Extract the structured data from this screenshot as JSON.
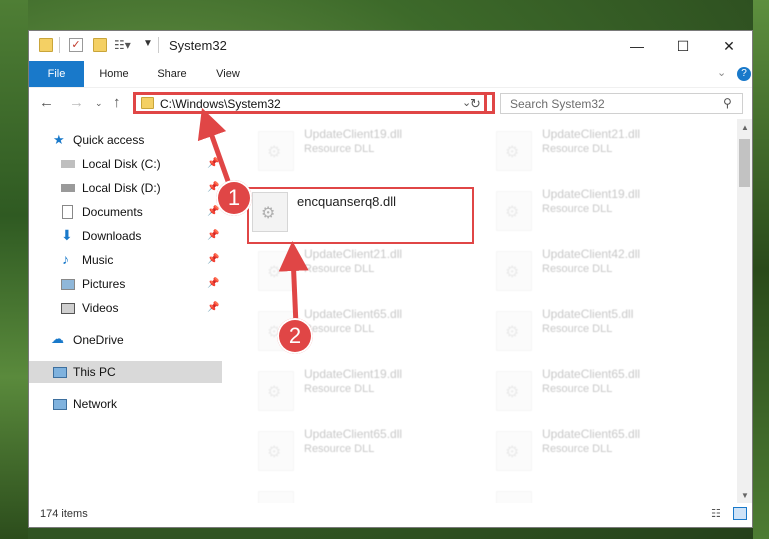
{
  "window": {
    "title": "System32"
  },
  "ribbon": {
    "tabs": [
      "File",
      "Home",
      "Share",
      "View"
    ]
  },
  "address": {
    "path": "C:\\Windows\\System32"
  },
  "search": {
    "placeholder": "Search System32"
  },
  "sidebar": {
    "items": [
      {
        "label": "Quick access"
      },
      {
        "label": "Local Disk (C:)"
      },
      {
        "label": "Local Disk (D:)"
      },
      {
        "label": "Documents"
      },
      {
        "label": "Downloads"
      },
      {
        "label": "Music"
      },
      {
        "label": "Pictures"
      },
      {
        "label": "Videos"
      },
      {
        "label": "OneDrive"
      },
      {
        "label": "This PC"
      },
      {
        "label": "Network"
      }
    ]
  },
  "files": [
    {
      "name": "UpdateClient19.dll",
      "type": "Resource DLL"
    },
    {
      "name": "UpdateClient21.dll",
      "type": "Resource DLL"
    },
    {
      "name": "encquanserq8.dll",
      "type": ""
    },
    {
      "name": "UpdateClient19.dll",
      "type": "Resource DLL"
    },
    {
      "name": "UpdateClient21.dll",
      "type": "Resource DLL"
    },
    {
      "name": "UpdateClient42.dll",
      "type": "Resource DLL"
    },
    {
      "name": "UpdateClient65.dll",
      "type": "Resource DLL"
    },
    {
      "name": "UpdateClient5.dll",
      "type": "Resource DLL"
    },
    {
      "name": "UpdateClient19.dll",
      "type": "Resource DLL"
    },
    {
      "name": "UpdateClient65.dll",
      "type": "Resource DLL"
    },
    {
      "name": "UpdateClient65.dll",
      "type": "Resource DLL"
    },
    {
      "name": "UpdateClient65.dll",
      "type": "Resource DLL"
    }
  ],
  "status": {
    "count": "174 items"
  },
  "annotations": {
    "step1": "1",
    "step2": "2"
  },
  "colors": {
    "accent": "#1979ca",
    "highlight": "#e04646"
  }
}
